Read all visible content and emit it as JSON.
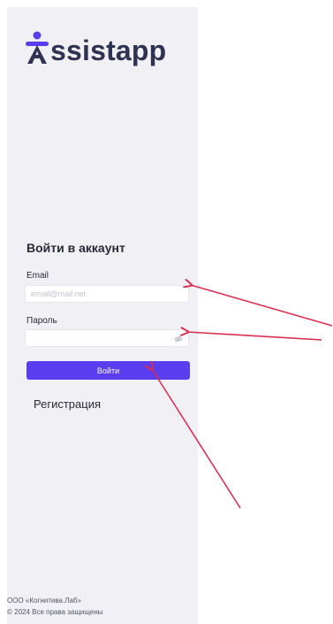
{
  "brand": {
    "logo_text": "ssistapp",
    "logo_icon": "accessibility-figure-A-icon"
  },
  "login": {
    "heading": "Войти в аккаунт",
    "email_label": "Email",
    "email_placeholder": "email@mail.net",
    "email_value": "",
    "password_label": "Пароль",
    "password_value": "",
    "password_toggle_icon": "eye-off-icon",
    "submit_label": "Войти",
    "register_label": "Регистрация"
  },
  "footer": {
    "company": "ООО «Когнитива.Лаб»",
    "copyright": "© 2024 Все права защищены"
  },
  "colors": {
    "panel_bg": "#f0f0f5",
    "accent": "#5b3df0",
    "annotation_arrow": "#d9304f"
  }
}
